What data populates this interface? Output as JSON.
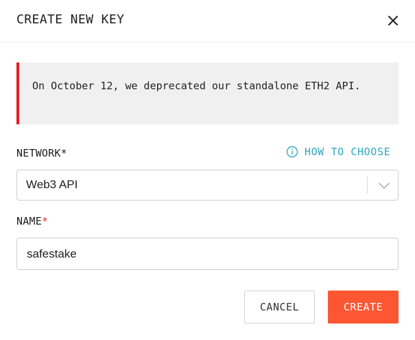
{
  "dialog": {
    "title": "CREATE NEW KEY",
    "close_icon": "close-icon"
  },
  "notice": {
    "text": "On October 12, we deprecated our standalone ETH2 API.",
    "accent_color": "#e31b23"
  },
  "network": {
    "label": "NETWORK",
    "required_mark": "*",
    "help_icon": "info-icon",
    "help_link": "HOW TO CHOOSE",
    "selected_value": "Web3 API",
    "dropdown_icon": "chevron-down-icon"
  },
  "name": {
    "label": "NAME",
    "required_mark": "*",
    "value": "safestake"
  },
  "actions": {
    "cancel_label": "CANCEL",
    "create_label": "CREATE",
    "create_color": "#fd5632"
  }
}
